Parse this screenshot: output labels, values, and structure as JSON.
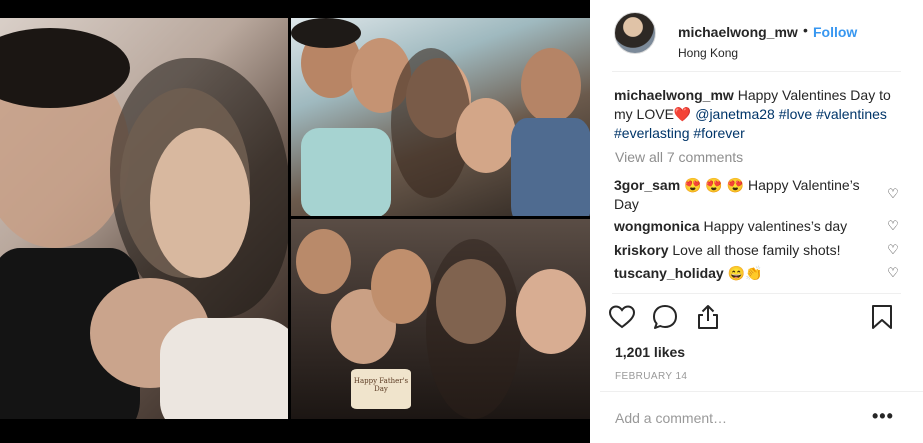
{
  "post": {
    "username": "michaelwong_mw",
    "dot": "•",
    "follow_label": "Follow",
    "location": "Hong Kong",
    "caption": {
      "username": "michaelwong_mw",
      "text": "Happy Valentines Day to my LOVE",
      "heart": "❤️",
      "mention": "@janetma28",
      "tags": [
        "#love",
        "#valentines",
        "#everlasting",
        "#forever"
      ]
    },
    "view_all_comments": "View all 7 comments",
    "comments": [
      {
        "user": "3gor_sam",
        "text": "😍 😍 😍 Happy Valentine’s Day"
      },
      {
        "user": "wongmonica",
        "text": "Happy valentines’s day"
      },
      {
        "user": "kriskory",
        "text": "Love all those family shots!"
      },
      {
        "user": "tuscany_holiday",
        "text": "😄👏"
      }
    ],
    "likes": "1,201 likes",
    "date": "FEBRUARY 14",
    "add_comment_placeholder": "Add a comment…",
    "more_label": "•••",
    "photo_cake_text": "Happy Father's Day"
  },
  "icons": {
    "like": "heart-outline-icon",
    "comment": "comment-bubble-icon",
    "share": "share-icon",
    "save": "bookmark-icon",
    "comment_like": "small-heart-icon"
  },
  "colors": {
    "link_blue": "#3897f0",
    "tag_blue": "#003569",
    "muted": "#8e8e8e"
  }
}
